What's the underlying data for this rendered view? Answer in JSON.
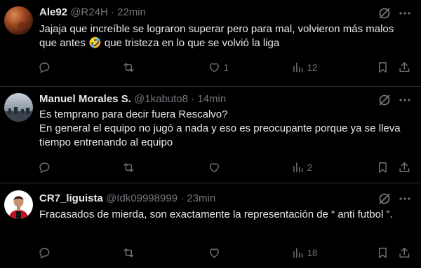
{
  "tweets": [
    {
      "name": "Ale92",
      "handle": "@R24H",
      "separator": "·",
      "time": "22min",
      "text": "Jajaja que increíble se lograron superar pero para mal, volvieron más malos que antes 🤣 que tristeza en lo que se volvió la liga",
      "replies": "",
      "reposts": "",
      "likes": "1",
      "views": "12"
    },
    {
      "name": "Manuel Morales S.",
      "handle": "@1kabuto8",
      "separator": "·",
      "time": "14min",
      "text": "Es temprano para decir fuera Rescalvo?\nEn general el equipo no jugó a nada y eso es preocupante porque ya se lleva tiempo entrenando al equipo",
      "replies": "",
      "reposts": "",
      "likes": "",
      "views": "2"
    },
    {
      "name": "CR7_liguista",
      "handle": "@Idk09998999",
      "separator": "·",
      "time": "23min",
      "text": "Fracasados de mierda, son exactamente la representación de “ anti futbol ”.",
      "replies": "",
      "reposts": "",
      "likes": "",
      "views": "18"
    }
  ],
  "icons": {
    "reply": "reply-icon",
    "repost": "repost-icon",
    "like": "heart-icon",
    "views": "views-icon",
    "bookmark": "bookmark-icon",
    "share": "share-icon",
    "grok": "grok-icon",
    "more": "more-icon"
  },
  "colors": {
    "background": "#000000",
    "text": "#e7e9ea",
    "muted": "#71767b",
    "divider": "#2f3336"
  }
}
